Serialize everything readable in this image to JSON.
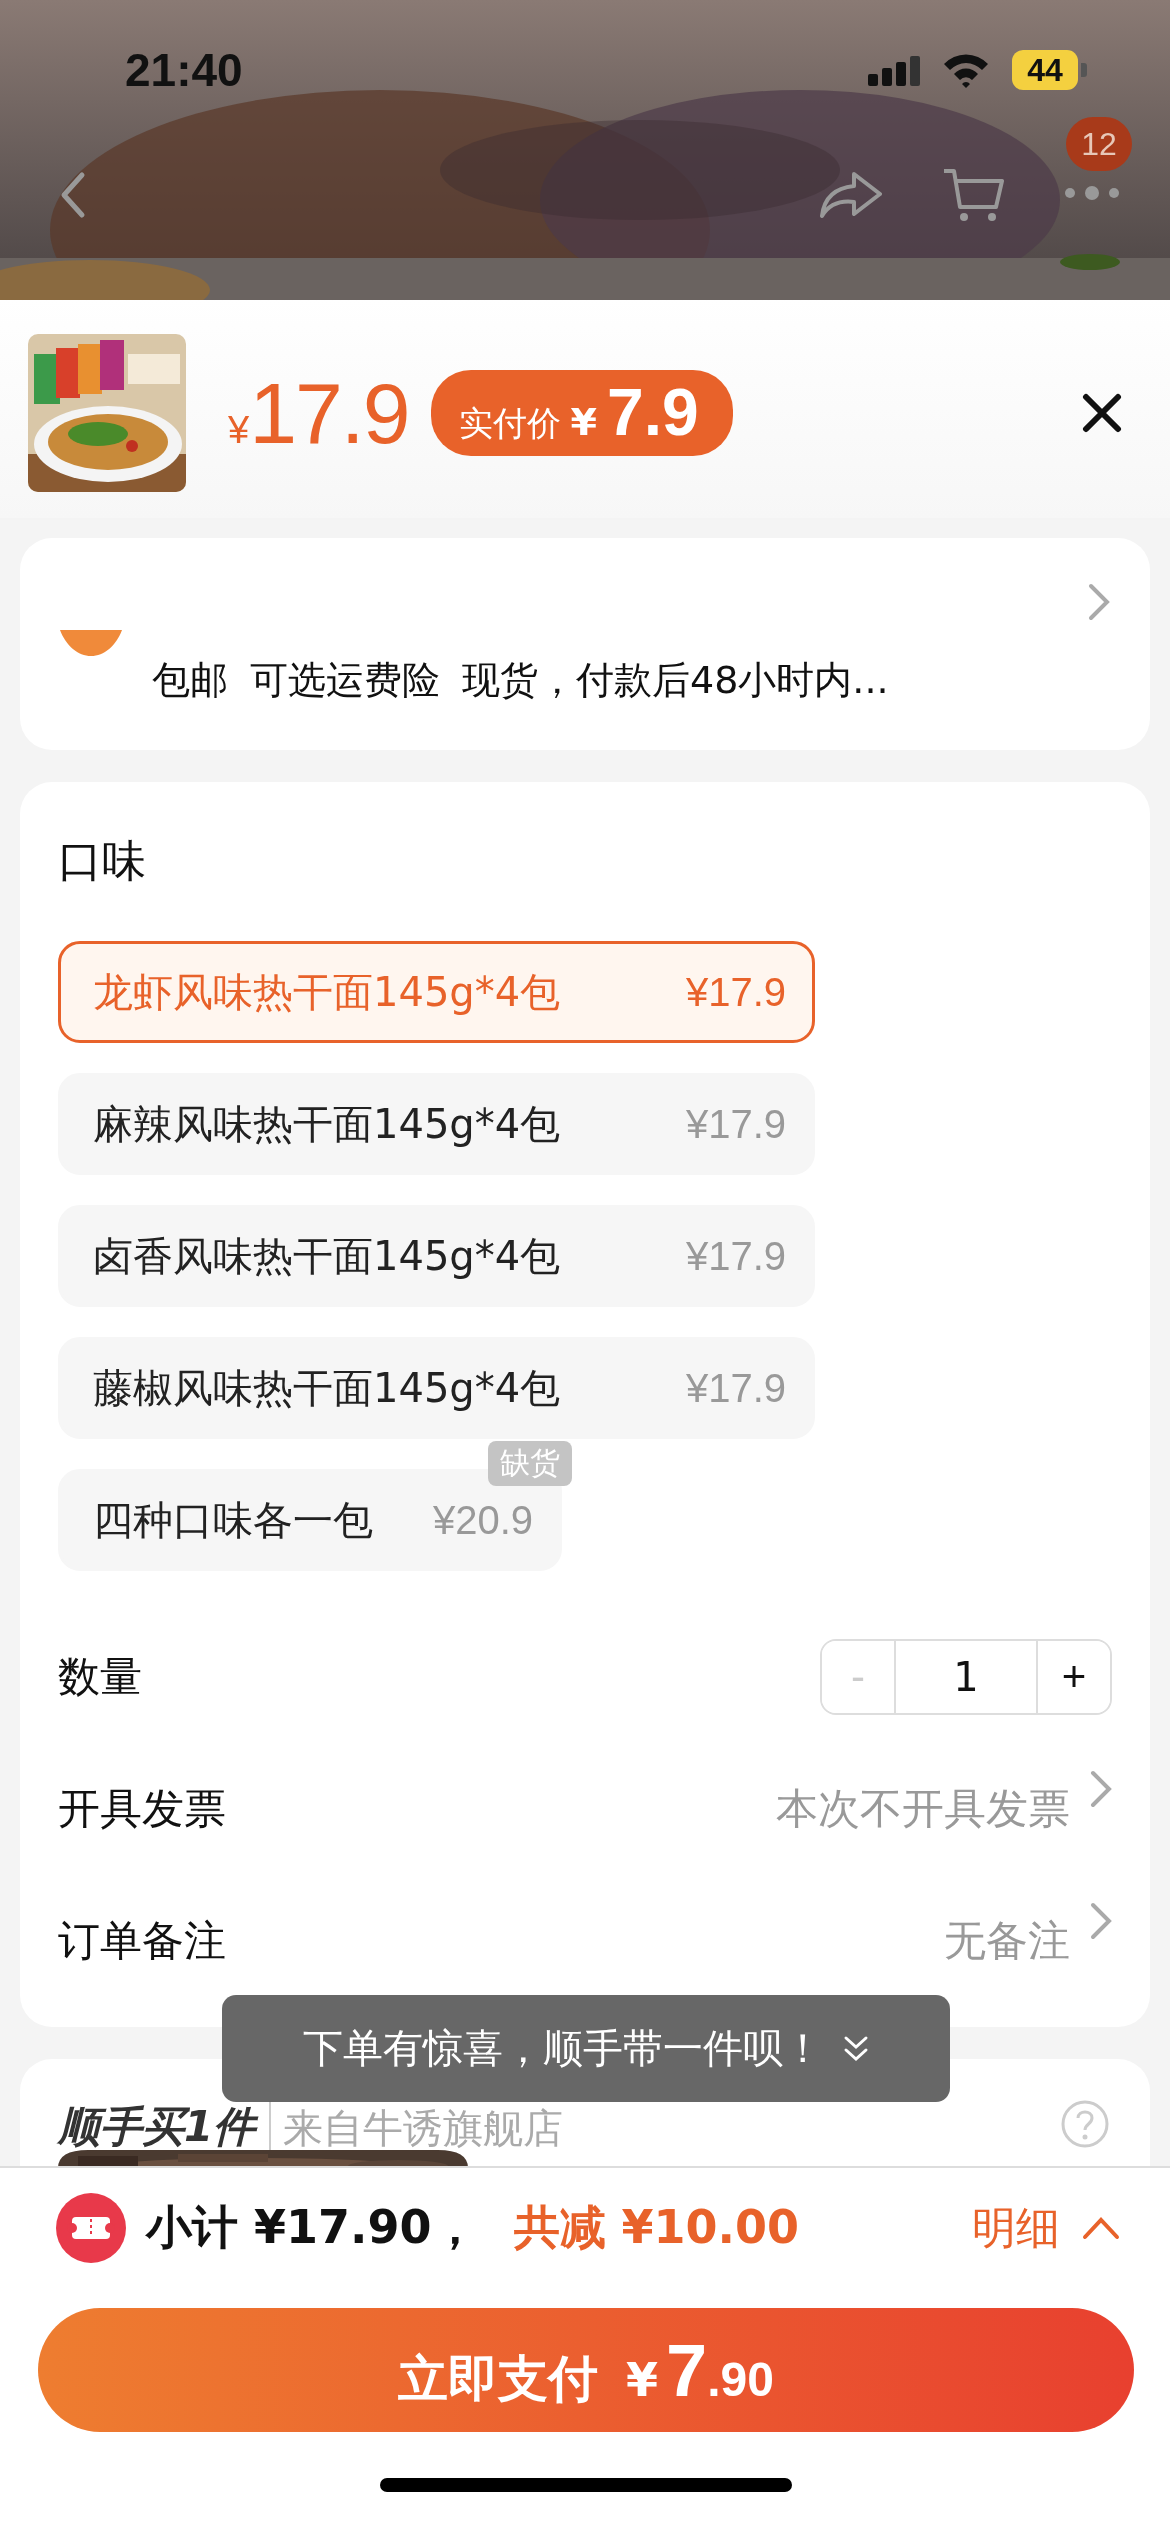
{
  "status_bar": {
    "time": "21:40",
    "battery": "44"
  },
  "nav": {
    "badge": "12"
  },
  "product": {
    "price_symbol": "¥",
    "price": "17.9",
    "actual_label": "实付价",
    "actual_symbol": "¥",
    "actual_price": "7.9"
  },
  "delivery": {
    "tags": [
      "包邮",
      "可选运费险",
      "现货，付款后48小时内..."
    ]
  },
  "flavor": {
    "title": "口味",
    "options": [
      {
        "name": "龙虾风味热干面145g*4包",
        "price": "¥17.9",
        "selected": true
      },
      {
        "name": "麻辣风味热干面145g*4包",
        "price": "¥17.9",
        "selected": false
      },
      {
        "name": "卤香风味热干面145g*4包",
        "price": "¥17.9",
        "selected": false
      },
      {
        "name": "藤椒风味热干面145g*4包",
        "price": "¥17.9",
        "selected": false
      },
      {
        "name": "四种口味各一包",
        "price": "¥20.9",
        "selected": false,
        "badge": "缺货"
      }
    ]
  },
  "quantity": {
    "label": "数量",
    "minus": "-",
    "value": "1",
    "plus": "+",
    "minus_disabled": true
  },
  "rows": [
    {
      "label": "开具发票",
      "value": "本次不开具发票"
    },
    {
      "label": "订单备注",
      "value": "无备注"
    }
  ],
  "addon": {
    "title": "顺手买1件",
    "source": "来自牛诱旗舰店"
  },
  "toast": {
    "text": "下单有惊喜，顺手带一件呗！"
  },
  "summary": {
    "subtotal_label": "小计",
    "subtotal": "¥17.90，",
    "discount_label": "共减",
    "discount": "¥10.00",
    "detail": "明细"
  },
  "pay_button": {
    "label": "立即支付",
    "symbol": "¥",
    "integer": "7",
    "decimal": ".90"
  }
}
